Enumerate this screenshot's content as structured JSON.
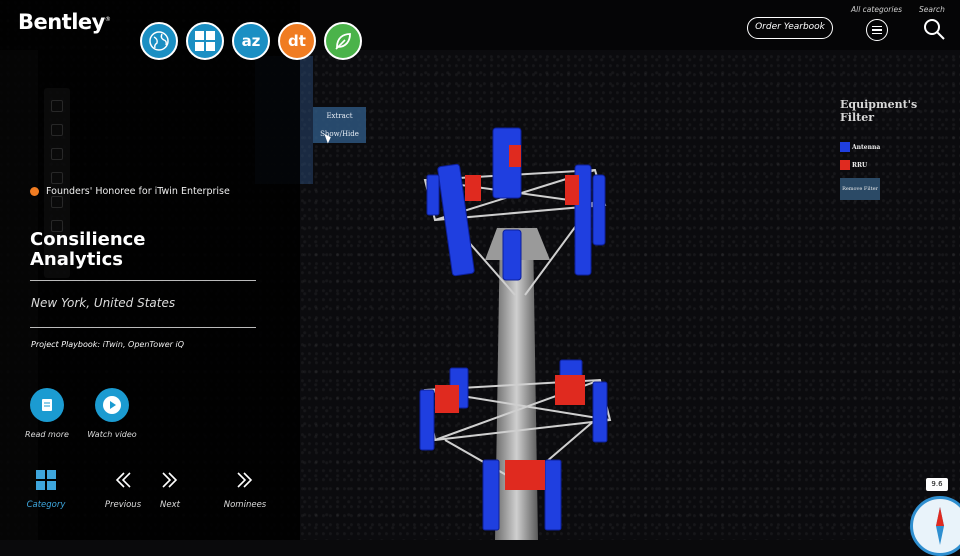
{
  "brand": {
    "name": "Bentley",
    "mark": "®"
  },
  "categories": [
    {
      "name": "globe-icon",
      "color": "#1b8fc3"
    },
    {
      "name": "grid-icon",
      "color": "#1b8fc3"
    },
    {
      "name": "az-icon",
      "text": "az",
      "color": "#1b8fc3"
    },
    {
      "name": "dt-icon",
      "text": "dt",
      "color": "#f07c22"
    },
    {
      "name": "leaf-icon",
      "color": "#4bb34a"
    }
  ],
  "award": {
    "label": "Founders' Honoree for iTwin Enterprise",
    "dot_color": "#f07c22"
  },
  "project": {
    "company_line1": "Consilience",
    "company_line2": "Analytics",
    "location": "New York, United States",
    "playbook_label": "Project Playbook:",
    "playbook_value": "iTwin, OpenTower iQ"
  },
  "actions": {
    "read_more": "Read more",
    "watch_video": "Watch video"
  },
  "nav": {
    "category": "Category",
    "previous": "Previous",
    "next": "Next",
    "nominees": "Nominees"
  },
  "topbar": {
    "order_yearbook": "Order Yearbook",
    "all_categories": "All categories",
    "search": "Search"
  },
  "viewer": {
    "menu_extract": "Extract",
    "menu_showhide": "Show/Hide",
    "filter_title": "Equipment's Filter",
    "legend": [
      {
        "label": "Antenna",
        "color": "#1f3fe0"
      },
      {
        "label": "RRU",
        "color": "#e02a1f"
      }
    ],
    "remove_filter": "Remove Filter",
    "scale": "9.6"
  }
}
